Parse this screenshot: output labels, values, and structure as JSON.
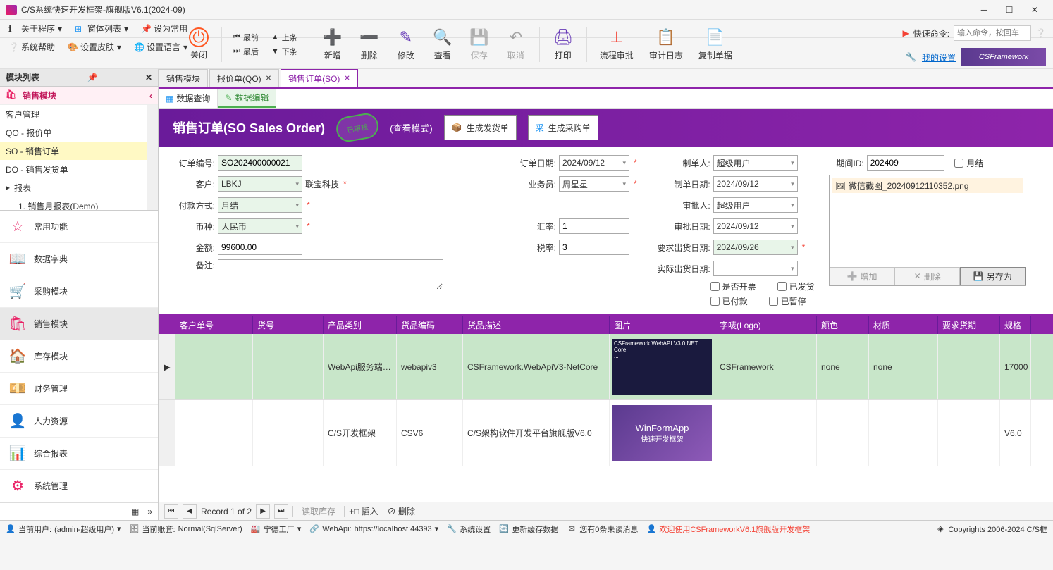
{
  "title": "C/S系统快速开发框架-旗舰版V6.1(2024-09)",
  "menubar": {
    "about": "关于程序",
    "winlist": "窗体列表",
    "setdefault": "设为常用",
    "syshelp": "系统帮助",
    "skin": "设置皮肤",
    "lang": "设置语言"
  },
  "toolbar": {
    "close": "关闭",
    "first": "最前",
    "prev": "上条",
    "last": "最后",
    "next": "下条",
    "add": "新增",
    "delete": "删除",
    "modify": "修改",
    "view": "查看",
    "save": "保存",
    "cancel": "取消",
    "print": "打印",
    "approve": "流程审批",
    "audit": "审计日志",
    "copy": "复制单据"
  },
  "quickcmd": {
    "label": "快速命令:",
    "placeholder": "输入命令，按回车"
  },
  "settings_link": "我的设置",
  "brand": "CSFramework",
  "sidebar": {
    "title": "模块列表",
    "active_module": "销售模块",
    "tree": [
      {
        "label": "客户管理",
        "level": 1
      },
      {
        "label": "QO - 报价单",
        "level": 1
      },
      {
        "label": "SO - 销售订单",
        "level": 1,
        "selected": true
      },
      {
        "label": "DO - 销售发货单",
        "level": 1
      },
      {
        "label": "报表",
        "level": 1,
        "expandable": true
      },
      {
        "label": "1. 销售月报表(Demo)",
        "level": 2
      }
    ],
    "modules": [
      {
        "label": "常用功能",
        "icon": "star"
      },
      {
        "label": "数据字典",
        "icon": "dict"
      },
      {
        "label": "采购模块",
        "icon": "cart"
      },
      {
        "label": "销售模块",
        "icon": "bag",
        "active": true
      },
      {
        "label": "库存模块",
        "icon": "home"
      },
      {
        "label": "财务管理",
        "icon": "money"
      },
      {
        "label": "人力资源",
        "icon": "person"
      },
      {
        "label": "综合报表",
        "icon": "report"
      },
      {
        "label": "系统管理",
        "icon": "gear"
      }
    ]
  },
  "tabs": [
    {
      "label": "销售模块"
    },
    {
      "label": "报价单(QO)",
      "closable": true
    },
    {
      "label": "销售订单(SO)",
      "closable": true,
      "active": true
    }
  ],
  "subtabs": {
    "query": "数据查询",
    "edit": "数据编辑"
  },
  "form_header": {
    "title": "销售订单(SO Sales Order)",
    "stamp": "已审核",
    "view_mode": "(查看模式)",
    "gen_delivery": "生成发货单",
    "gen_purchase": "生成采购单"
  },
  "form": {
    "labels": {
      "order_no": "订单编号:",
      "customer": "客户:",
      "pay_method": "付款方式:",
      "currency": "币种:",
      "amount": "金额:",
      "remark": "备注:",
      "order_date": "订单日期:",
      "sales": "业务员:",
      "rate": "汇率:",
      "tax": "税率:",
      "creator": "制单人:",
      "create_date": "制单日期:",
      "approver": "审批人:",
      "approve_date": "审批日期:",
      "req_ship": "要求出货日期:",
      "actual_ship": "实际出货日期:",
      "period": "期间ID:",
      "monthly": "月结",
      "invoice": "是否开票",
      "shipped": "已发货",
      "paid": "已付款",
      "paused": "已暂停"
    },
    "values": {
      "order_no": "SO202400000021",
      "customer": "LBKJ",
      "customer_name": "联宝科技",
      "pay_method": "月结",
      "currency": "人民币",
      "amount": "99600.00",
      "order_date": "2024/09/12",
      "sales": "周星星",
      "rate": "1",
      "tax": "3",
      "creator": "超级用户",
      "create_date": "2024/09/12",
      "approver": "超级用户",
      "approve_date": "2024/09/12",
      "req_ship": "2024/09/26",
      "period": "202409"
    },
    "attachment": {
      "file": "微信截图_20240912110352.png",
      "add": "增加",
      "del": "删除",
      "save_as": "另存为"
    }
  },
  "grid": {
    "columns": [
      "客户单号",
      "货号",
      "产品类别",
      "货品编码",
      "货品描述",
      "图片",
      "字唛(Logo)",
      "颜色",
      "材质",
      "要求货期",
      "规格"
    ],
    "rows": [
      {
        "cust_no": "",
        "item_no": "",
        "category": "WebApi服务端…",
        "code": "webapiv3",
        "desc": "CSFramework.WebApiV3-NetCore",
        "logo": "CSFramework",
        "color": "none",
        "material": "none",
        "date": "",
        "spec": "17000",
        "selected": true
      },
      {
        "cust_no": "",
        "item_no": "",
        "category": "C/S开发框架",
        "code": "CSV6",
        "desc": "C/S架构软件开发平台旗舰版V6.0",
        "logo": "",
        "color": "",
        "material": "",
        "date": "",
        "spec": "V6.0",
        "img2": {
          "title": "WinFormApp",
          "sub": "快速开发框架"
        }
      }
    ]
  },
  "nav_footer": {
    "record": "Record 1 of 2",
    "read_lib": "读取库存",
    "insert": "插入",
    "delete": "删除"
  },
  "statusbar": {
    "user_label": "当前用户:",
    "user": "(admin-超级用户)",
    "account_label": "当前账套:",
    "account": "Normal(SqlServer)",
    "factory": "宁德工厂",
    "webapi_label": "WebApi:",
    "webapi": "https://localhost:44393",
    "sys_settings": "系统设置",
    "refresh_cache": "更新缓存数据",
    "messages": "您有0条未读消息",
    "welcome": "欢迎使用CSFrameworkV6.1旗舰版开发框架",
    "copyright": "Copyrights 2006-2024 C/S框"
  }
}
